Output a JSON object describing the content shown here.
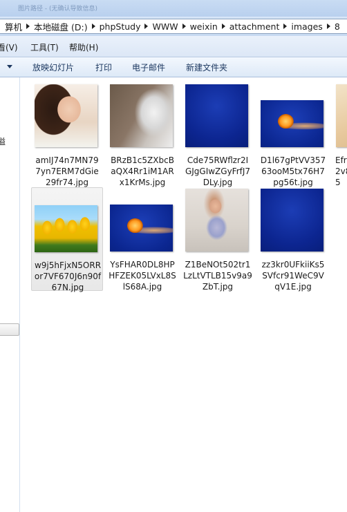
{
  "window": {
    "title_fragment": "图片路径 - (无确认导致信息)"
  },
  "address": {
    "crumbs": [
      "算机",
      "本地磁盘 (D:)",
      "phpStudy",
      "WWW",
      "weixin",
      "attachment",
      "images",
      "8"
    ]
  },
  "menu": {
    "items": [
      "看(V)",
      "工具(T)",
      "帮助(H)"
    ]
  },
  "toolbar": {
    "buttons": [
      "放映幻灯片",
      "打印",
      "电子邮件",
      "新建文件夹"
    ]
  },
  "navpane": {
    "glyph": "溢"
  },
  "files": [
    {
      "line1": "amIJ74n7MN79",
      "line2": "7yn7ERM7dGie",
      "line3": "29fr74.jpg",
      "thumb": "portrait"
    },
    {
      "line1": "BRzB1c5ZXbcB",
      "line2": "aQX4Rr1iM1AR",
      "line3": "x1KrMs.jpg",
      "thumb": "fur"
    },
    {
      "line1": "Cde75RWflzr2I",
      "line2": "GJgGIwZGyFrfJ7",
      "line3": "DLy.jpg",
      "thumb": "blue"
    },
    {
      "line1": "D1l67gPtVV357",
      "line2": "63ooM5tx76H7",
      "line3": "pg56t.jpg",
      "thumb": "jellyfish"
    },
    {
      "line1": "Efr",
      "line2": "2v8",
      "line3": "5",
      "thumb": "portrait-partial"
    },
    {
      "line1": "w9j5hFjxN5ORR",
      "line2": "or7VF670J6n90f",
      "line3": "67N.jpg",
      "thumb": "tulips",
      "selected": true
    },
    {
      "line1": "YsFHAR0DL8HP",
      "line2": "HFZEK05LVxL8S",
      "line3": "lS68A.jpg",
      "thumb": "jellyfish"
    },
    {
      "line1": "Z1BeNOt502tr1",
      "line2": "LzLtVTLB15v9a9",
      "line3": "ZbT.jpg",
      "thumb": "dress"
    },
    {
      "line1": "zz3kr0UFkiiKs5",
      "line2": "SVfcr91WeC9V",
      "line3": "qV1E.jpg",
      "thumb": "blue"
    }
  ]
}
